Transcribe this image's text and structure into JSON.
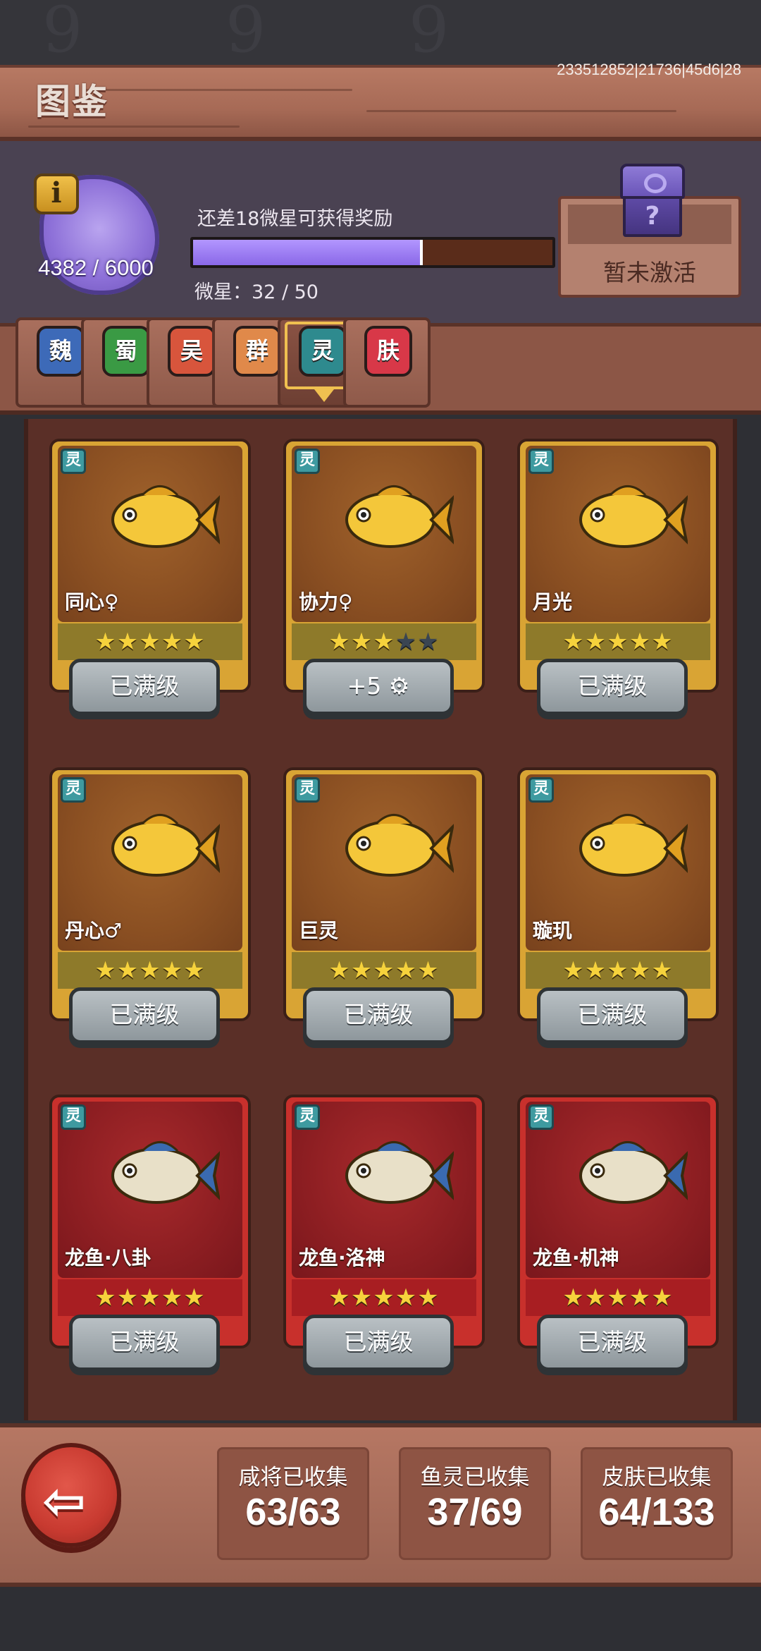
{
  "header": {
    "title": "图鉴",
    "build_id": "233512852|21736|45d6|28"
  },
  "collection": {
    "points": "4382 / 6000",
    "reward_hint": "还差18微星可获得奖励",
    "micro_star_label": "微星：32 / 50",
    "micro_star_progress": 0.64,
    "inactive_label": "暂未激活"
  },
  "tabs": [
    {
      "label": "魏",
      "color": "#3d6ab8"
    },
    {
      "label": "蜀",
      "color": "#3a9a44"
    },
    {
      "label": "吴",
      "color": "#d8553c"
    },
    {
      "label": "群",
      "color": "#e0894a"
    },
    {
      "label": "灵",
      "color": "#2e8a8e",
      "active": true
    },
    {
      "label": "肤",
      "color": "#d83848"
    }
  ],
  "cards": [
    {
      "tag": "灵",
      "name": "同心♀",
      "stars": 5,
      "button": "已满级",
      "rarity": "gold"
    },
    {
      "tag": "灵",
      "name": "协力♀",
      "stars": 3,
      "button": "+5 ⚙",
      "rarity": "gold"
    },
    {
      "tag": "灵",
      "name": "月光",
      "stars": 5,
      "button": "已满级",
      "rarity": "gold"
    },
    {
      "tag": "灵",
      "name": "丹心♂",
      "stars": 5,
      "button": "已满级",
      "rarity": "gold"
    },
    {
      "tag": "灵",
      "name": "巨灵",
      "stars": 5,
      "button": "已满级",
      "rarity": "gold"
    },
    {
      "tag": "灵",
      "name": "璇玑",
      "stars": 5,
      "button": "已满级",
      "rarity": "gold"
    },
    {
      "tag": "灵",
      "name": "龙鱼·八卦",
      "stars": 5,
      "button": "已满级",
      "rarity": "red"
    },
    {
      "tag": "灵",
      "name": "龙鱼·洛神",
      "stars": 5,
      "button": "已满级",
      "rarity": "red"
    },
    {
      "tag": "灵",
      "name": "龙鱼·机神",
      "stars": 5,
      "button": "已满级",
      "rarity": "red"
    }
  ],
  "stats": [
    {
      "label": "咸将已收集",
      "value": "63/63"
    },
    {
      "label": "鱼灵已收集",
      "value": "37/69"
    },
    {
      "label": "皮肤已收集",
      "value": "64/133"
    }
  ],
  "icons": {
    "back": "back-arrow-icon",
    "info": "info-icon",
    "chest": "mystery-chest-icon"
  }
}
